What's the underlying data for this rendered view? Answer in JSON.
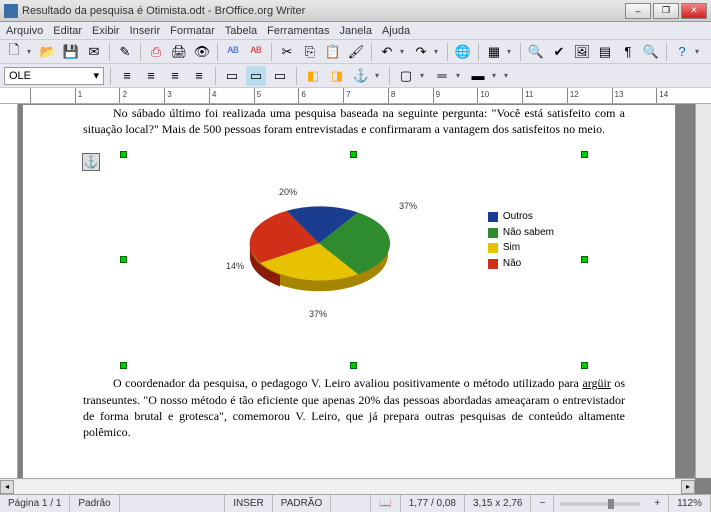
{
  "window": {
    "title": "Resultado da pesquisa é Otimista.odt - BrOffice.org Writer"
  },
  "menu": [
    "Arquivo",
    "Editar",
    "Exibir",
    "Inserir",
    "Formatar",
    "Tabela",
    "Ferramentas",
    "Janela",
    "Ajuda"
  ],
  "style_box": "OLE",
  "ruler_ticks": [
    "-",
    "6",
    "-",
    "",
    "-",
    "1",
    "-",
    "2",
    "-",
    "3",
    "-",
    "4",
    "-",
    "5",
    "-",
    "6",
    "-",
    "7",
    "-",
    "8",
    "-",
    "9",
    "-",
    "10",
    "-",
    "11",
    "-",
    "12",
    "-",
    "13",
    "-",
    "14"
  ],
  "doc": {
    "p1": "No sábado último foi realizada uma pesquisa baseada na seguinte pergunta: \"Você está satisfeito com a situação local?\" Mais de 500 pessoas foram entrevistadas e confirmaram a vantagem dos satisfeitos no meio.",
    "p2_a": "O coordenador da pesquisa, o pedagogo V. Leiro avaliou positivamente o método utilizado para ",
    "p2_u": "argüir",
    "p2_b": " os transeuntes. \"O nosso método é tão eficiente que apenas 20% das pessoas abordadas ameaçaram o entrevistador de forma brutal e grotesca\", comemorou V. Leiro, que já prepara outras pesquisas de conteúdo altamente polêmico."
  },
  "chart_data": {
    "type": "pie",
    "title": "",
    "series": [
      {
        "name": "Outros",
        "value": 20,
        "color": "#1a3d8f",
        "label": "20%"
      },
      {
        "name": "Não sabem",
        "value": 37,
        "color": "#2e8b2e",
        "label": "37%"
      },
      {
        "name": "Sim",
        "value": 37,
        "color": "#e6c200",
        "label": "37%"
      },
      {
        "name": "Não",
        "value": 14,
        "color": "#d03018",
        "label": "14%"
      }
    ],
    "legend": [
      "Outros",
      "Não sabem",
      "Sim",
      "Não"
    ]
  },
  "status": {
    "page": "Página 1 / 1",
    "style": "Padrão",
    "pos": "1,77 / 0,08",
    "inser": "INSER",
    "padrao": "PADRÃO",
    "size": "3,15 x 2,76",
    "zoom": "112%"
  }
}
